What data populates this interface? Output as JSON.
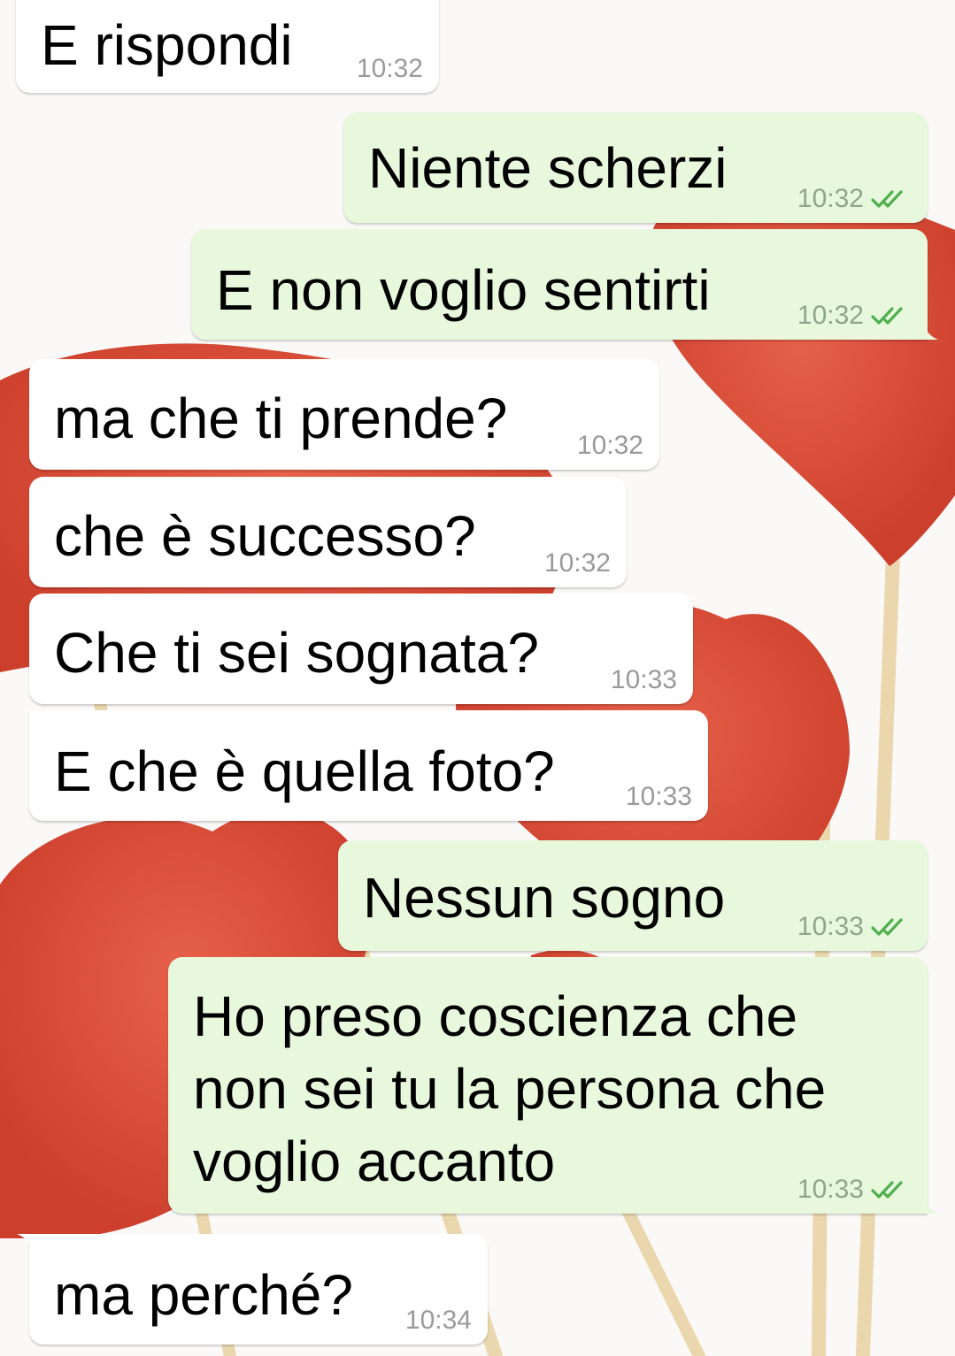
{
  "chat": {
    "messages": [
      {
        "direction": "incoming",
        "text": "E rispondi",
        "time": "10:32"
      },
      {
        "direction": "outgoing",
        "text": "Niente scherzi",
        "time": "10:32",
        "read": true
      },
      {
        "direction": "outgoing",
        "text": "E non voglio sentirti",
        "time": "10:32",
        "read": true
      },
      {
        "direction": "incoming",
        "text": "ma che ti prende?",
        "time": "10:32"
      },
      {
        "direction": "incoming",
        "text": "che è successo?",
        "time": "10:32"
      },
      {
        "direction": "incoming",
        "text": "Che ti sei sognata?",
        "time": "10:33"
      },
      {
        "direction": "incoming",
        "text": "E che è quella foto?",
        "time": "10:33"
      },
      {
        "direction": "outgoing",
        "text": "Nessun sogno",
        "time": "10:33",
        "read": true
      },
      {
        "direction": "outgoing",
        "text": "Ho preso coscienza che\nnon sei tu la persona che\nvoglio accanto",
        "time": "10:33",
        "read": true
      },
      {
        "direction": "incoming",
        "text": "ma perché?",
        "time": "10:34"
      }
    ]
  },
  "colors": {
    "incoming_bubble": "#ffffff",
    "outgoing_bubble": "#e7f8dc",
    "read_ticks": "#4fae4f",
    "wallpaper_hearts": "#d9503a",
    "wallpaper_sticks": "#e9d4a8"
  },
  "icons": {
    "read_receipt": "double-check-icon",
    "wallpaper": "red-heart-lollipops-wallpaper"
  }
}
